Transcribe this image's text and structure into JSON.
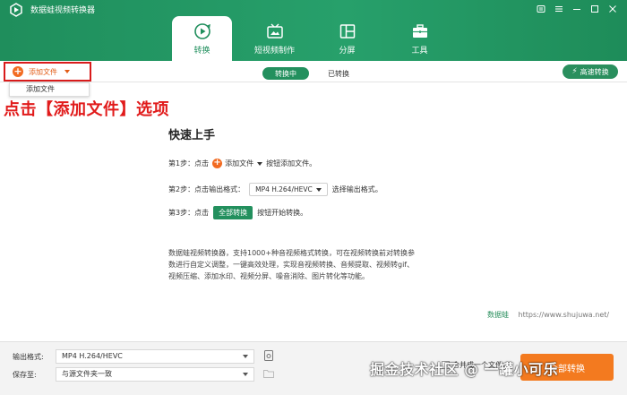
{
  "app": {
    "title": "数据蛙视频转换器"
  },
  "nav": {
    "tabs": [
      {
        "label": "转换",
        "icon": "convert-icon",
        "active": true
      },
      {
        "label": "短视频制作",
        "icon": "short-video-icon",
        "active": false
      },
      {
        "label": "分屏",
        "icon": "split-screen-icon",
        "active": false
      },
      {
        "label": "工具",
        "icon": "toolbox-icon",
        "active": false
      }
    ]
  },
  "toolbar": {
    "add_file": "添加文件",
    "converting": "转换中",
    "converted": "已转换",
    "fast_convert": "高速转换"
  },
  "dropdown": {
    "item": "添加文件"
  },
  "annotation": "点击【添加文件】选项",
  "quickstart": {
    "title": "快速上手",
    "step1_label": "第1步：点击",
    "step1_add": "添加文件",
    "step1_suffix": "按钮添加文件。",
    "step2_label": "第2步：点击输出格式：",
    "step2_format": "MP4 H.264/HEVC",
    "step2_suffix": "选择输出格式。",
    "step3_label": "第3步：点击",
    "step3_btn": "全部转换",
    "step3_suffix": "按钮开始转换。",
    "description": [
      "数据蛙视频转换器，支持1000+种音视频格式转换，可在视频转换前对转换参",
      "数进行自定义调整，一键高效处理，实现音视频转换、音频提取、视频转gif、",
      "视频压缩、添加水印、视频分屏、噪音消除、图片转化等功能。"
    ],
    "brand": "数据蛙",
    "url": "https://www.shujuwa.net/"
  },
  "bottom": {
    "output_label": "输出格式:",
    "output_value": "MP4 H.264/HEVC",
    "save_label": "保存至:",
    "save_value": "与源文件夹一致",
    "merge_label": "合并成一个文件",
    "convert_all": "全部转换"
  },
  "watermark": "掘金技术社区 @ 一罐小可乐",
  "colors": {
    "brand_green": "#23905e",
    "accent_orange": "#f37a1f",
    "highlight_red": "#d91b1b"
  }
}
